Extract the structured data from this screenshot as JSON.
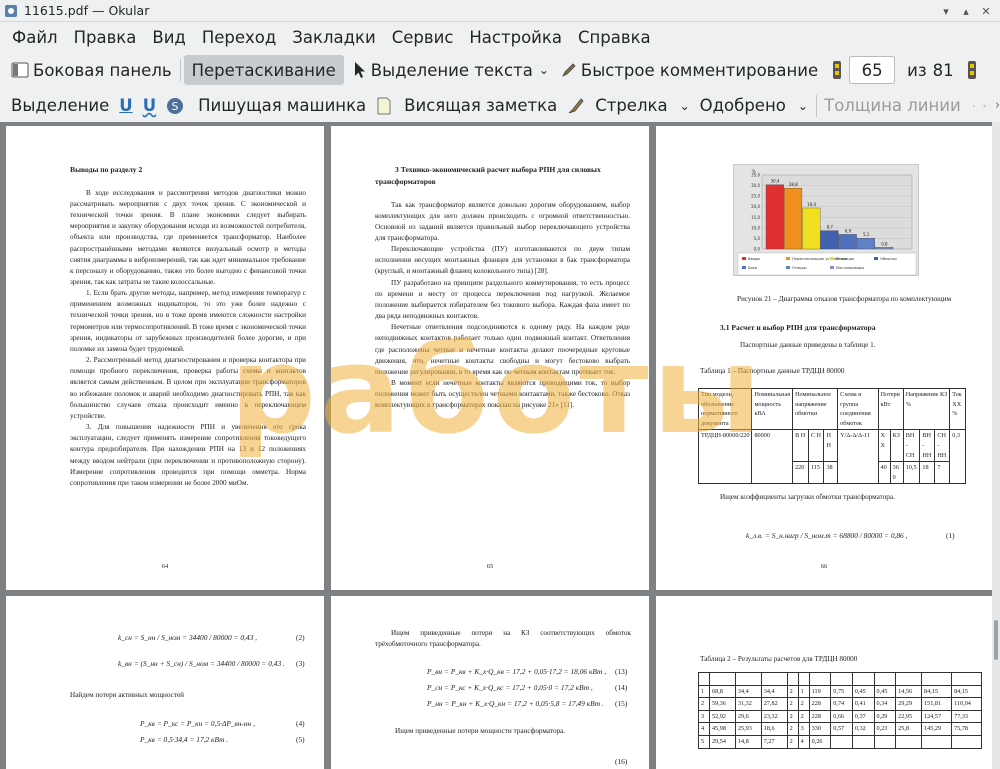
{
  "window": {
    "title": "11615.pdf — Okular"
  },
  "menu": [
    "Файл",
    "Правка",
    "Вид",
    "Переход",
    "Закладки",
    "Сервис",
    "Настройка",
    "Справка"
  ],
  "toolbar1": {
    "sidebar": "Боковая панель",
    "drag": "Перетаскивание",
    "text_select": "Выделение текста",
    "quick_comment": "Быстрое комментирование",
    "page_current": "65",
    "page_of": "из",
    "page_total": "81"
  },
  "toolbar2": {
    "highlight": "Выделение",
    "underline1": "U",
    "underline2": "U",
    "typewriter": "Пишущая машинка",
    "note": "Висящая заметка",
    "arrow": "Стрелка",
    "approved": "Одобрено",
    "line_width": "Толщина линии"
  },
  "watermark": "работы",
  "p64": {
    "title": "Выводы по разделу 2",
    "paras": [
      "В ходе исследования и рассмотрения методов диагностики можно рассматривать мероприятия с двух точек зрения. С экономической и технической точки зрения. В плане экономики следует выбирать мероприятия и закупку оборудования исходя из возможностей потребителя, объекта или производства, где применяется трансформатор. Наиболее распространёнными методами являются визуальный осмотр и методы снятия диаграммы в виброизмерений, так как идет минимальное требование к персоналу и оборудованию, также это более выгодно с финансовой точки зрения, так как затраты не такие колоссальные.",
      "1. Если брать другие методы, например, метод измерения температур с применением возможных индикаторов, то это уже более надежно с технической точки зрения, но в тоже время имеются сложности настройки термометров или термосопротивлений. В тоже время с экономической точки зрения, индикаторы от зарубежных производителей более дорогие, и при поломке их замена будет трудоемкой.",
      "2. Рассмотренный метод диагностирования и проверка контактора при помощи пробного переключения, проверка работы схемы и контактов является самым действенным. В целом при эксплуатации трансформаторов во избежание поломок и аварий необходимо диагностировать РПН, так как большинство случаев отказа происходит именно в переключающем устройстве.",
      "3. Для повышения надежности РПН и увеличения его срока эксплуатации, следует применять измерение сопротивления токоведущего контура предизбирателя. При нахождении РПН на 13 и 12 положениях между вводом нейтрали (при переключении и противоположную сторону). Измерение сопротивления проводится при помощи омметра. Норма сопротивления при таком измерении не более 2000 миОм."
    ],
    "num": "64"
  },
  "p65": {
    "title": "3 Технико-экономический расчет выбора РПН для силовых трансформаторов",
    "paras": [
      "Так как трансформатор является довольно дорогим оборудованием, выбор комплектующих для него должен происходить с огромной ответственностью. Основной из заданий является правильный выбор переключающего устройства для трансформатора.",
      "Переключающие устройства (ПУ) изготавливаются по двум типам исполнения несущих монтажных фланцев для установки в бак трансформатора (круглый, и монтажный фланец колокольного типа) [28].",
      "ПУ разработано на принципе раздельного коммутирования, то есть процесс по времени и месту от процесса переключения под нагрузкой. Желаемое положение выбирается избирателем без токового выбора. Каждая фаза имеет по два ряда неподвижных контактов.",
      "Нечетные ответвления подсоединяются к одному ряду. На каждом ряде неподвижных контактов работает только один подвижный контакт. Ответвления где расположены четные и нечетные контакты делают поочередные круговые движения, что, нечетные контакты свободны и могут бестоково выбрать положение регулирования, в то время как по четным контактам протекает ток.",
      "В момент если нечетные контакты являются проводящими ток, то выбор положения может быть осуществлен четными контактами, также бестоково. Отказ комплектующих в трансформаторах показан на рисунке 21» [11]."
    ],
    "num": "65"
  },
  "p66": {
    "caption": "Рисунок 21 – Диаграмма отказов трансформатора по комплектующим",
    "section": "3.1 Расчет и выбор РПН для трансформатора",
    "passport": "Паспортные данные приведены в таблице 1.",
    "table_title": "Таблица 1 – Паспортные данные ТРДЦН 80000",
    "table_headers": [
      "Тип модели, обозначение нормативного документа",
      "Номинальная мощность кВА",
      "Номинальное напряжение обмотки",
      "Схема и группа соединения обмоток",
      "Потери кВт",
      "Напряжение КЗ %",
      "Ток ХХ %"
    ],
    "row1": [
      "ТРДЦН-80000/220",
      "80000",
      "В Н",
      "С Н",
      "Н Н",
      "Y/Δ-Δ/Δ-11"
    ],
    "row2": [
      "220",
      "115",
      "38"
    ],
    "row_extra": [
      "Х Х",
      "КЗ",
      "ВН - СН",
      "ВН - НН",
      "СН - НН",
      "0,3"
    ],
    "row_vals": [
      "40",
      "36 0",
      "10,5",
      "18",
      "7"
    ],
    "find": "Ищем коэффициенты загрузки обмотки трансформатора.",
    "formula": "k_л.в. = S_н.нагр / S_ном.т = 68800 / 80000 = 0,86 ,",
    "fnum": "(1)",
    "num": "66"
  },
  "p67": {
    "f2": "k_сн = S_нн / S_ном = 34400 / 80000 = 0,43 ,",
    "n2": "(2)",
    "f3": "k_вн = (S_нн + S_сн) / S_ном = 34400 / 80000 = 0,43 .",
    "n3": "(3)",
    "txt": "Найдем потери активных мощностей",
    "f4": "P_кв = P_кс = P_кн = 0,5·ΔP_вн-нн ,",
    "n4": "(4)",
    "f5": "P_кв = 0,5·34,4 = 17,2 кВт .",
    "n5": "(5)"
  },
  "p68": {
    "txt": "Ищем приведенные потери на КЗ соответствующих обмоток трёхобмоточного трансформатора.",
    "f13": "P_вн = P_кв + K_x·Q_кв = 17,2 + 0,05·17,2 = 18,06 кВт ,",
    "n13": "(13)",
    "f14": "P_сн = P_кс + K_x·Q_кс = 17,2 + 0,05·0 = 17,2 кВт ,",
    "n14": "(14)",
    "f15": "P_нн = P_кн + K_x·Q_кн = 17,2 + 0,05·5,8 = 17,49 кВт .",
    "n15": "(15)",
    "txt2": "Ищем приведенные потери мощности трансформатора.",
    "n16": "(16)"
  },
  "p69": {
    "table_title": "Таблица 2 – Результаты расчетов для ТРДЦН 80000",
    "rows": [
      [
        "1",
        "68,8",
        "34,4",
        "34,4",
        "2",
        "1",
        "119",
        "0,75",
        "0,45",
        "0,45",
        "14,56",
        "84,15",
        "84,15"
      ],
      [
        "2",
        "59,36",
        "31,32",
        "27,82",
        "2",
        "2",
        "228",
        "0,74",
        "0,41",
        "0,34",
        "29,29",
        "151,81",
        "110,04"
      ],
      [
        "3",
        "52,92",
        "29,6",
        "23,32",
        "2",
        "2",
        "228",
        "0,66",
        "0,37",
        "0,29",
        "22,95",
        "124,57",
        "77,33"
      ],
      [
        "4",
        "45,98",
        "25,93",
        "18,6",
        "2",
        "3",
        "330",
        "0,57",
        "0,32",
        "0,23",
        "25,8",
        "145,29",
        "75,78"
      ],
      [
        "5",
        "29,54",
        "14,8",
        "7,27",
        "2",
        "4",
        "0,26",
        "",
        "",
        "",
        "",
        "",
        ""
      ]
    ]
  },
  "chart_data": {
    "type": "bar",
    "categories": [
      "Вводы",
      "Переключающие устройства",
      "Изоляция",
      "Обмотки",
      "Баки",
      "Отводы",
      "Маслопроводы"
    ],
    "values": [
      30.4,
      28.8,
      19.4,
      8.7,
      6.9,
      5.1,
      0.8
    ],
    "value_labels": [
      "30,4",
      "28,8",
      "19,4",
      "8,7",
      "6,9",
      "5,1",
      "0,8"
    ],
    "colors": [
      "#e03030",
      "#f09020",
      "#f0e020",
      "#4060b0",
      "#5070c0",
      "#6080c8",
      "#8090c0"
    ],
    "ylabel": "%",
    "yticks": [
      "0,0",
      "5,0",
      "10,0",
      "15,0",
      "20,0",
      "25,0",
      "30,0",
      "35,0"
    ],
    "ylim": [
      0,
      35
    ],
    "legend": "bottom",
    "grid": true
  }
}
